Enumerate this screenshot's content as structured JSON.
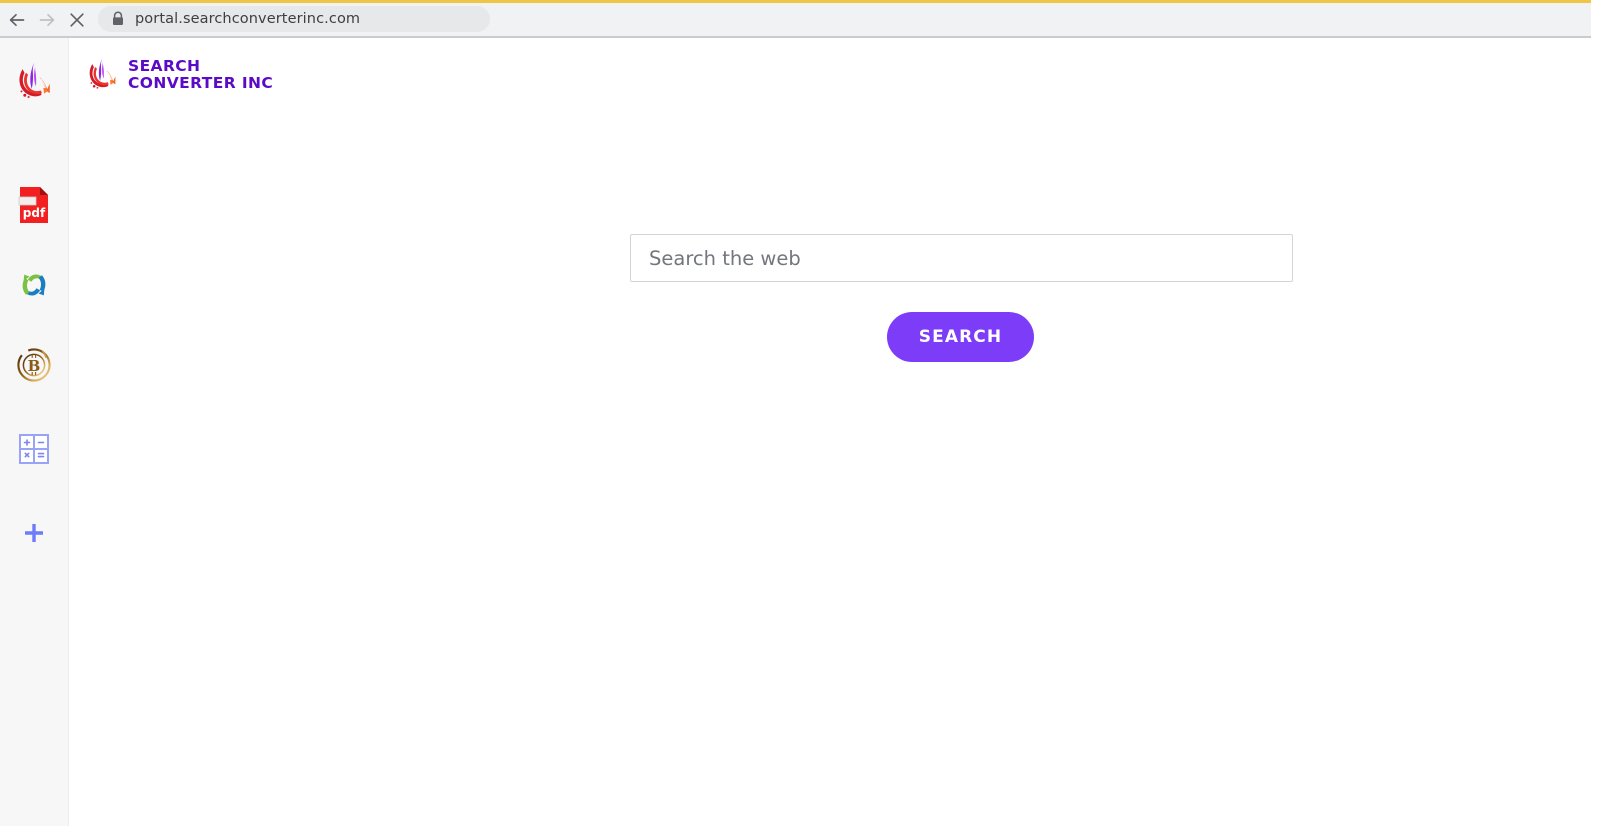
{
  "browser": {
    "back_icon": "arrow-left-icon",
    "forward_icon": "arrow-right-icon",
    "stop_icon": "close-x-icon",
    "lock_icon": "lock-icon",
    "url": "portal.searchconverterinc.com",
    "accent_color": "#eec643",
    "toolbar_color": "#f1f2f4"
  },
  "sidebar": {
    "background_color": "#f7f7f8",
    "items": [
      {
        "id": "brand",
        "icon": "brand-swoosh-icon",
        "label": "Search Converter brand"
      },
      {
        "id": "pdf",
        "icon": "pdf-file-icon",
        "label": "pdf"
      },
      {
        "id": "convert",
        "icon": "convert-arrows-icon",
        "label": "Convert"
      },
      {
        "id": "bitcoin",
        "icon": "bitcoin-icon",
        "label": "Bitcoin"
      },
      {
        "id": "calculator",
        "icon": "calculator-icon",
        "label": "Calculator"
      },
      {
        "id": "add",
        "icon": "plus-icon",
        "label": "Add"
      }
    ],
    "collapse_handle": {
      "icon": "chevron-left-icon",
      "color": "#3d3546"
    }
  },
  "logo": {
    "icon": "brand-swoosh-icon",
    "line1": "SEARCH",
    "line2": "CONVERTER INC",
    "color": "#5b0ac6"
  },
  "search": {
    "placeholder": "Search the web",
    "value": "",
    "button_label": "SEARCH",
    "button_color": "#7d3cf8"
  }
}
